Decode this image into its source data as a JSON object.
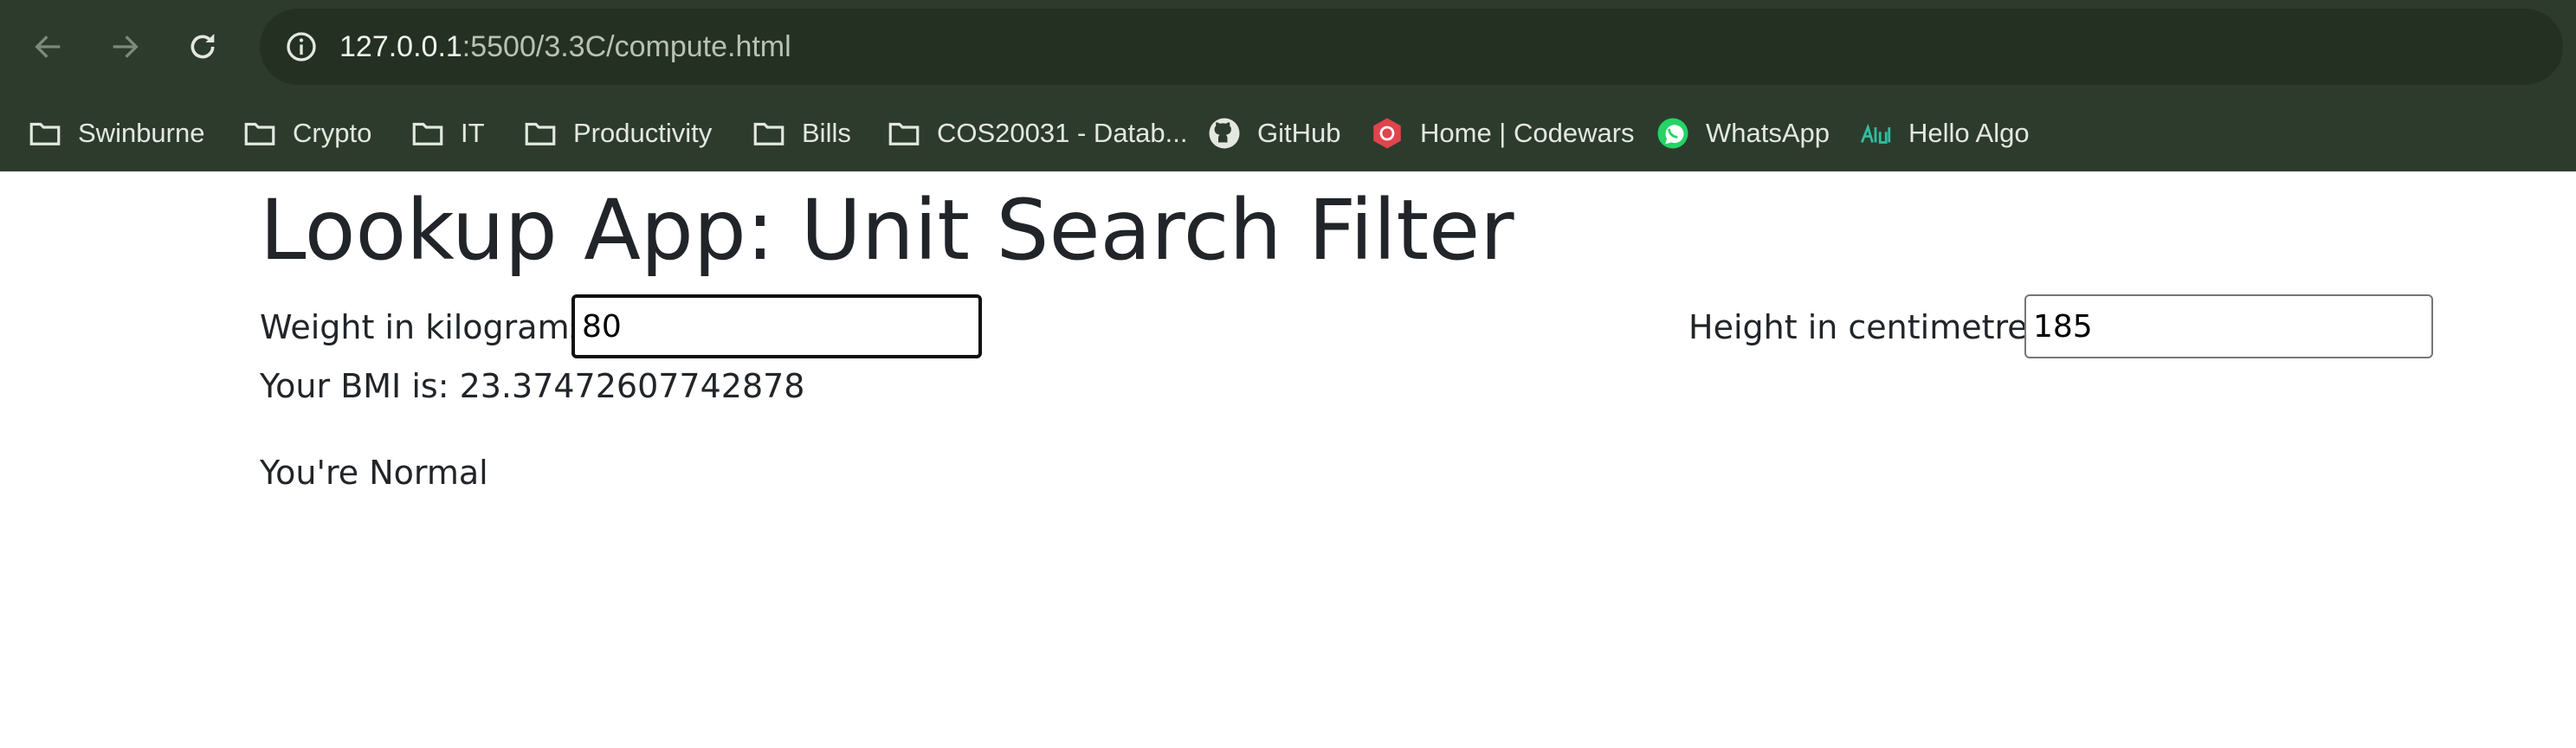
{
  "browser": {
    "url_host": "127.0.0.1",
    "url_rest": ":5500/3.3C/compute.html",
    "bookmarks": [
      {
        "label": "Swinburne",
        "icon": "folder-icon"
      },
      {
        "label": "Crypto",
        "icon": "folder-icon"
      },
      {
        "label": "IT",
        "icon": "folder-icon"
      },
      {
        "label": "Productivity",
        "icon": "folder-icon"
      },
      {
        "label": "Bills",
        "icon": "folder-icon"
      },
      {
        "label": "COS20031 - Datab...",
        "icon": "folder-icon"
      },
      {
        "label": "GitHub",
        "icon": "github-icon"
      },
      {
        "label": "Home | Codewars",
        "icon": "codewars-icon"
      },
      {
        "label": "WhatsApp",
        "icon": "whatsapp-icon"
      },
      {
        "label": "Hello Algo",
        "icon": "hello-algo-icon"
      }
    ]
  },
  "page": {
    "title": "Lookup App: Unit Search Filter",
    "weight_label": "Weight in kilograms:",
    "weight_value": "80",
    "height_label": "Height in centimetres:",
    "height_value": "185",
    "bmi_text": "Your BMI is: 23.37472607742878",
    "status_text": "You're Normal"
  },
  "colors": {
    "chrome_bg": "#2d3b2c",
    "omnibox_bg": "#243022",
    "text_dark": "#212529"
  }
}
